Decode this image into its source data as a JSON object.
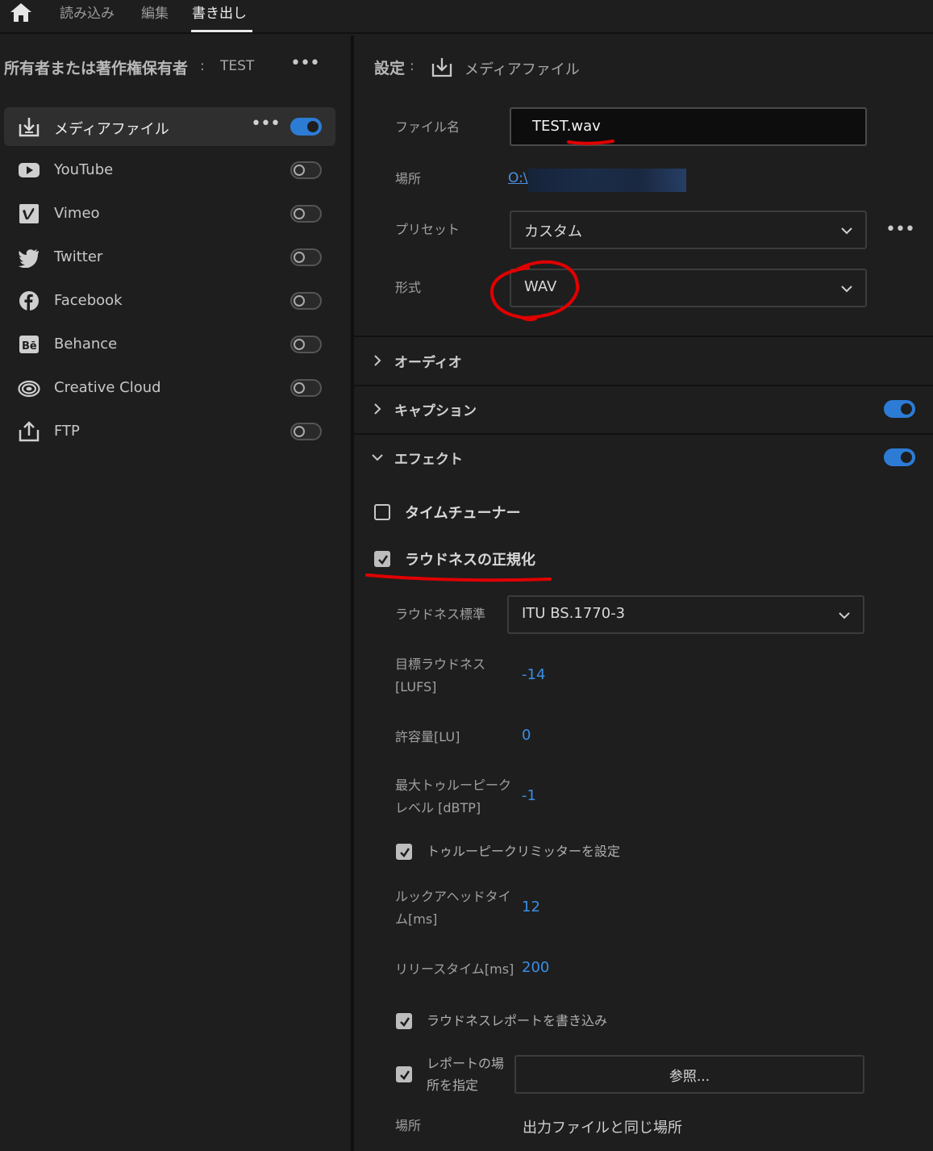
{
  "nav": {
    "tabs": [
      "読み込み",
      "編集",
      "書き出し"
    ],
    "active_tab": "書き出し"
  },
  "owner": {
    "label": "所有者または著作権保有者",
    "colon": ":",
    "value": "TEST"
  },
  "destinations": [
    {
      "label": "メディアファイル",
      "icon": "download-icon",
      "enabled": true
    },
    {
      "label": "YouTube",
      "icon": "youtube-icon",
      "enabled": false
    },
    {
      "label": "Vimeo",
      "icon": "vimeo-icon",
      "enabled": false
    },
    {
      "label": "Twitter",
      "icon": "twitter-icon",
      "enabled": false
    },
    {
      "label": "Facebook",
      "icon": "facebook-icon",
      "enabled": false
    },
    {
      "label": "Behance",
      "icon": "behance-icon",
      "enabled": false
    },
    {
      "label": "Creative Cloud",
      "icon": "creative-cloud-icon",
      "enabled": false
    },
    {
      "label": "FTP",
      "icon": "upload-icon",
      "enabled": false
    }
  ],
  "settings": {
    "header_label": "設定",
    "colon": ":",
    "target": "メディアファイル",
    "filename_label": "ファイル名",
    "filename_value": "TEST.wav",
    "location_label": "場所",
    "location_value": "O:\\",
    "preset_label": "プリセット",
    "preset_value": "カスタム",
    "format_label": "形式",
    "format_value": "WAV"
  },
  "sections": {
    "audio": "オーディオ",
    "captions": "キャプション",
    "effects": "エフェクト"
  },
  "effects": {
    "time_tuner": "タイムチューナー",
    "time_tuner_checked": false,
    "loudness_normalize": "ラウドネスの正規化",
    "loudness_normalize_checked": true,
    "standard_label": "ラウドネス標準",
    "standard_value": "ITU BS.1770-3",
    "target_label_1": "目標ラウドネス",
    "target_label_2": "[LUFS]",
    "target_value": "-14",
    "tolerance_label": "許容量[LU]",
    "tolerance_value": "0",
    "max_peak_label_1": "最大トゥルーピーク",
    "max_peak_label_2": "レベル [dBTP]",
    "max_peak_value": "-1",
    "limiter_label": "トゥルーピークリミッターを設定",
    "limiter_checked": true,
    "lookahead_label_1": "ルックアヘッドタイ",
    "lookahead_label_2": "ム[ms]",
    "lookahead_value": "12",
    "release_label": "リリースタイム[ms]",
    "release_value": "200",
    "report_label": "ラウドネスレポートを書き込み",
    "report_checked": true,
    "report_loc_label_1": "レポートの場",
    "report_loc_label_2": "所を指定",
    "report_loc_checked": true,
    "browse_button": "参照...",
    "place_label": "場所",
    "place_value": "出力ファイルと同じ場所"
  },
  "colors": {
    "accent": "#2c7cd6",
    "link": "#4a90e2",
    "annotation": "#e00000"
  }
}
